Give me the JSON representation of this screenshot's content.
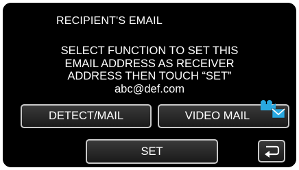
{
  "screen": {
    "title": "RECIPIENT'S EMAIL",
    "message_lines": [
      "SELECT FUNCTION TO SET THIS",
      "EMAIL ADDRESS AS RECEIVER",
      "ADDRESS THEN TOUCH “SET”"
    ],
    "email": "abc@def.com"
  },
  "buttons": {
    "detect_mail": "DETECT/MAIL",
    "video_mail": "VIDEO MAIL",
    "set": "SET"
  },
  "icons": {
    "video_mail": "video-mail-icon",
    "back": "return-arrow-icon"
  },
  "colors": {
    "background": "#000000",
    "text": "#ffffff",
    "icon_accent": "#29a8e0"
  }
}
